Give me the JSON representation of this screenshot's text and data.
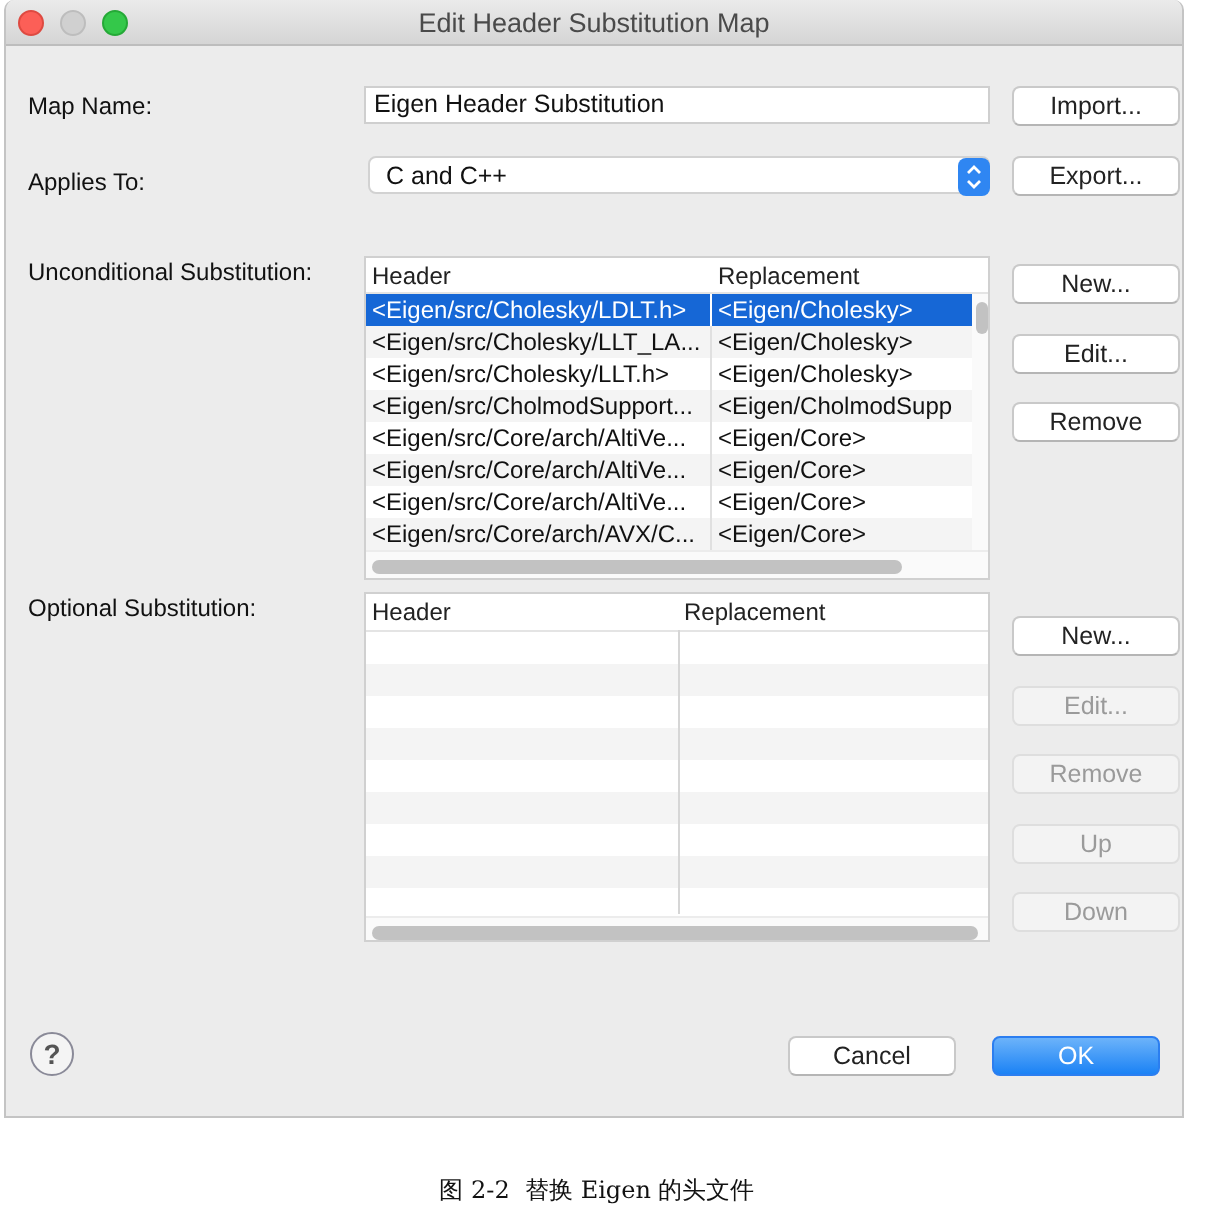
{
  "window": {
    "title": "Edit Header Substitution Map"
  },
  "map_name": {
    "label": "Map Name:",
    "value": "Eigen Header Substitution"
  },
  "applies_to": {
    "label": "Applies To:",
    "value": "C and C++"
  },
  "side_buttons": [
    {
      "label": "Import...",
      "disabled": false
    },
    {
      "label": "Export...",
      "disabled": false
    }
  ],
  "unconditional": {
    "label": "Unconditional Substitution:",
    "columns": [
      "Header",
      "Replacement"
    ],
    "rows": [
      {
        "header": "<Eigen/src/Cholesky/LDLT.h>",
        "replacement": "<Eigen/Cholesky>",
        "selected": true
      },
      {
        "header": "<Eigen/src/Cholesky/LLT_LA...",
        "replacement": "<Eigen/Cholesky>",
        "selected": false
      },
      {
        "header": "<Eigen/src/Cholesky/LLT.h>",
        "replacement": "<Eigen/Cholesky>",
        "selected": false
      },
      {
        "header": "<Eigen/src/CholmodSupport...",
        "replacement": "<Eigen/CholmodSupp",
        "selected": false
      },
      {
        "header": "<Eigen/src/Core/arch/AltiVe...",
        "replacement": "<Eigen/Core>",
        "selected": false
      },
      {
        "header": "<Eigen/src/Core/arch/AltiVe...",
        "replacement": "<Eigen/Core>",
        "selected": false
      },
      {
        "header": "<Eigen/src/Core/arch/AltiVe...",
        "replacement": "<Eigen/Core>",
        "selected": false
      },
      {
        "header": "<Eigen/src/Core/arch/AVX/C...",
        "replacement": "<Eigen/Core>",
        "selected": false
      }
    ],
    "buttons": [
      {
        "label": "New...",
        "disabled": false
      },
      {
        "label": "Edit...",
        "disabled": false
      },
      {
        "label": "Remove",
        "disabled": false
      }
    ]
  },
  "optional": {
    "label": "Optional Substitution:",
    "columns": [
      "Header",
      "Replacement"
    ],
    "buttons": [
      {
        "label": "New...",
        "disabled": false
      },
      {
        "label": "Edit...",
        "disabled": true
      },
      {
        "label": "Remove",
        "disabled": true
      },
      {
        "label": "Up",
        "disabled": true
      },
      {
        "label": "Down",
        "disabled": true
      }
    ]
  },
  "help_button": {
    "label": "?"
  },
  "footer_buttons": [
    {
      "label": "Cancel",
      "primary": false
    },
    {
      "label": "OK",
      "primary": true
    }
  ],
  "caption": "图 2-2  替换 Eigen 的头文件"
}
